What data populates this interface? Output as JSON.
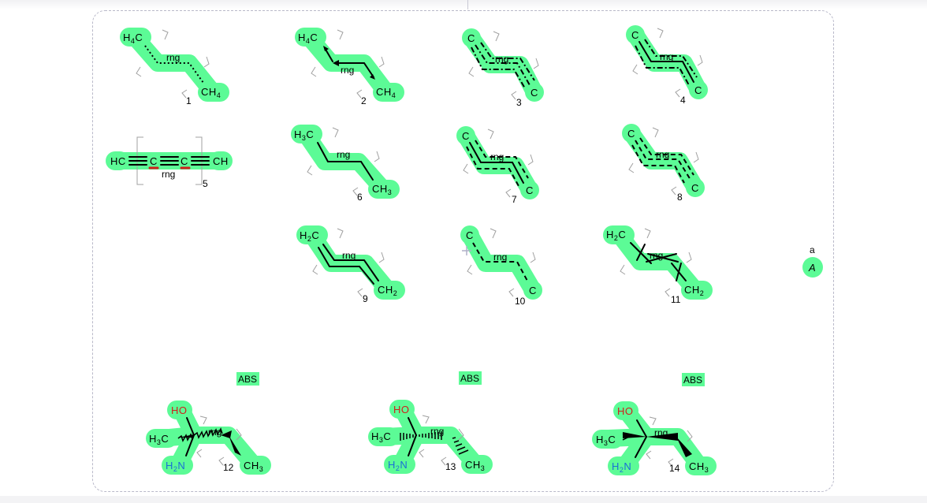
{
  "canvas": {
    "highlight_color": "#5cfb96",
    "frame_color": "#b9b9c9"
  },
  "labels": {
    "rng": "rng",
    "abs": "ABS",
    "rgroup_label": "a",
    "rgroup_atom": "A"
  },
  "structures": [
    {
      "number": "1",
      "left": "H4C",
      "right": "CH4",
      "bond_style": "dotted"
    },
    {
      "number": "2",
      "left": "H4C",
      "right": "CH4",
      "bond_style": "arrows"
    },
    {
      "number": "3",
      "left": "C",
      "right": "C",
      "bond_style": "dash-dot double"
    },
    {
      "number": "4",
      "left": "C",
      "right": "C",
      "bond_style": "single + dash-dot"
    },
    {
      "number": "5",
      "left": "HC",
      "middle1": "C",
      "middle2": "C",
      "right": "CH",
      "bond_style": "triple"
    },
    {
      "number": "6",
      "left": "H3C",
      "right": "CH3",
      "bond_style": "single"
    },
    {
      "number": "7",
      "left": "C",
      "right": "C",
      "bond_style": "single + dashed"
    },
    {
      "number": "8",
      "left": "C",
      "right": "C",
      "bond_style": "dashed double"
    },
    {
      "number": "9",
      "left": "H2C",
      "right": "CH2",
      "bond_style": "double"
    },
    {
      "number": "10",
      "left": "C",
      "right": "C",
      "bond_style": "dashed"
    },
    {
      "number": "11",
      "left": "H2C",
      "right": "CH2",
      "bond_style": "crossed double"
    },
    {
      "number": "12",
      "ho": "HO",
      "me": "H3C",
      "nh": "H2N",
      "right": "CH3",
      "stereo": "ABS"
    },
    {
      "number": "13",
      "ho": "HO",
      "me": "H3C",
      "nh": "H2N",
      "right": "CH3",
      "stereo": "ABS"
    },
    {
      "number": "14",
      "ho": "HO",
      "me": "H3C",
      "nh": "H2N",
      "right": "CH3",
      "stereo": "ABS"
    }
  ]
}
